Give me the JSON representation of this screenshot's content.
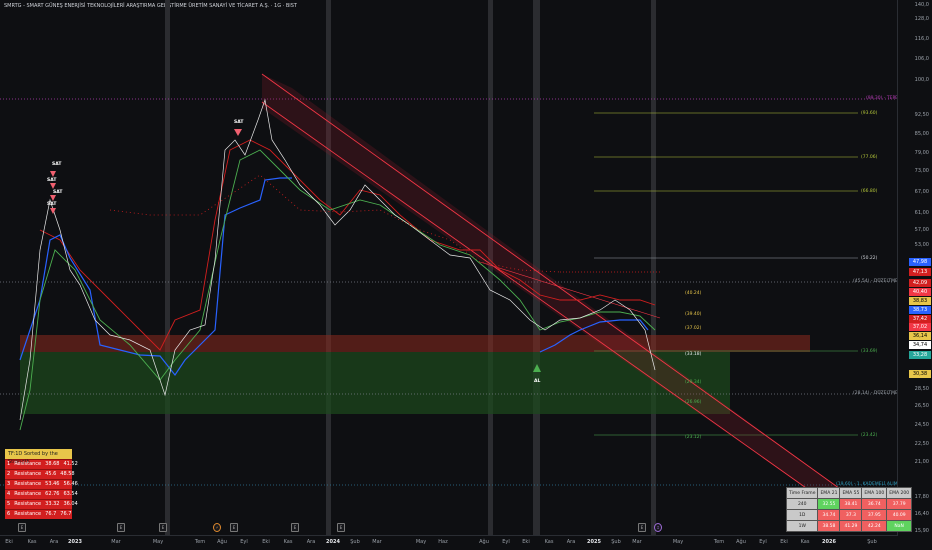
{
  "title": "SMRTG - SMART GÜNEŞ ENERJİSİ TEKNOLOJİLERİ ARAŞTIRMA GELİŞTİRME ÜRETİM SANAYİ VE TİCARET A.Ş. · 1G · BIST",
  "y_axis": {
    "scale": "log",
    "ticks": [
      "140,0",
      "128,0",
      "116,0",
      "106,0",
      "100,0",
      "92,50",
      "85,00",
      "79,00",
      "73,00",
      "67,00",
      "61,00",
      "57,00",
      "53,00",
      "49,00",
      "45,00",
      "42,00",
      "39,00",
      "36,00",
      "33,00",
      "30,50",
      "28,50",
      "26,50",
      "24,50",
      "22,50",
      "21,00",
      "19,60",
      "17,80",
      "16,40",
      "15,90"
    ],
    "price_badges": [
      {
        "text": "47,98",
        "color": "#2962ff"
      },
      {
        "text": "47,13",
        "color": "#d21f1f"
      },
      {
        "text": "42,09",
        "color": "#d21f1f"
      },
      {
        "text": "40,40",
        "color": "#f23645"
      },
      {
        "text": "38,83",
        "color": "#e8c64a"
      },
      {
        "text": "38,73",
        "color": "#2962ff"
      },
      {
        "text": "37,42",
        "color": "#d21f1f"
      },
      {
        "text": "37,02",
        "color": "#f23645"
      },
      {
        "text": "36,00",
        "color": "#e08a2e"
      },
      {
        "text": "36,14",
        "color": "#e8c64a"
      },
      {
        "text": "34,74",
        "color": "#ffffff"
      },
      {
        "text": "33,28",
        "color": "#26a69a"
      },
      {
        "text": "30,38",
        "color": "#e8c64a"
      }
    ]
  },
  "x_axis": {
    "ticks": [
      {
        "label": "Eki",
        "bold": false
      },
      {
        "label": "Kas",
        "bold": false
      },
      {
        "label": "Ara",
        "bold": false
      },
      {
        "label": "2023",
        "bold": true
      },
      {
        "label": "Mar",
        "bold": false
      },
      {
        "label": "May",
        "bold": false
      },
      {
        "label": "Tem",
        "bold": false
      },
      {
        "label": "Ağu",
        "bold": false
      },
      {
        "label": "Eyl",
        "bold": false
      },
      {
        "label": "Eki",
        "bold": false
      },
      {
        "label": "Kas",
        "bold": false
      },
      {
        "label": "Ara",
        "bold": false
      },
      {
        "label": "2024",
        "bold": true
      },
      {
        "label": "Şub",
        "bold": false
      },
      {
        "label": "Mar",
        "bold": false
      },
      {
        "label": "May",
        "bold": false
      },
      {
        "label": "Haz",
        "bold": false
      },
      {
        "label": "Ağu",
        "bold": false
      },
      {
        "label": "Eyl",
        "bold": false
      },
      {
        "label": "Eki",
        "bold": false
      },
      {
        "label": "Kas",
        "bold": false
      },
      {
        "label": "Ara",
        "bold": false
      },
      {
        "label": "2025",
        "bold": true
      },
      {
        "label": "Şub",
        "bold": false
      },
      {
        "label": "Mar",
        "bold": false
      },
      {
        "label": "May",
        "bold": false
      },
      {
        "label": "Tem",
        "bold": false
      },
      {
        "label": "Ağu",
        "bold": false
      },
      {
        "label": "Eyl",
        "bold": false
      },
      {
        "label": "Eki",
        "bold": false
      },
      {
        "label": "Kas",
        "bold": false
      },
      {
        "label": "2026",
        "bold": true
      },
      {
        "label": "Şub",
        "bold": false
      }
    ]
  },
  "events": [
    "E",
    "E",
    "E",
    "E",
    "E",
    "E",
    "E"
  ],
  "annotations": {
    "top_level": "(99,30) - TEPE",
    "level_45": "(45,54) - DÜZELTME",
    "level_28": "(28,14) - DÜZELTME",
    "bottom_level": "(19,60) - 1. KADEMELİ ALIM",
    "fib_levels": [
      "(93.60)",
      "(77.06)",
      "(66.80)",
      "(50.22)",
      "(33.69)",
      "(23.42)"
    ],
    "channel_levels": [
      "(40.24)",
      "(39.40)",
      "(37.02)",
      "(33.18)",
      "(29.34)",
      "(26.96)",
      "(23.12)"
    ],
    "sell_label": "SAT",
    "buy_label": "AL"
  },
  "sr_panel": {
    "header": "TF:1D Sorted by the Strength",
    "rows": [
      {
        "n": "1",
        "type": "Resistance",
        "a": "38.68",
        "b": "41.52"
      },
      {
        "n": "2",
        "type": "Resistance",
        "a": "45.6",
        "b": "48.58"
      },
      {
        "n": "3",
        "type": "Resistance",
        "a": "53.46",
        "b": "56.46"
      },
      {
        "n": "4",
        "type": "Resistance",
        "a": "62.76",
        "b": "63.54"
      },
      {
        "n": "5",
        "type": "Resistance",
        "a": "33.32",
        "b": "36.04"
      },
      {
        "n": "6",
        "type": "Resistance",
        "a": "76.7",
        "b": "76.7"
      }
    ]
  },
  "ema_table": {
    "headers": [
      "Time Frame",
      "EMA 21",
      "EMA 55",
      "EMA 100",
      "EMA 200"
    ],
    "rows": [
      {
        "tf": "240",
        "vals": [
          {
            "t": "32.55",
            "c": "#5fd35f"
          },
          {
            "t": "38.41",
            "c": "#f06060"
          },
          {
            "t": "36.74",
            "c": "#f06060"
          },
          {
            "t": "37.79",
            "c": "#f06060"
          }
        ]
      },
      {
        "tf": "1D",
        "vals": [
          {
            "t": "34.74",
            "c": "#f06060"
          },
          {
            "t": "37.3",
            "c": "#f06060"
          },
          {
            "t": "37.95",
            "c": "#f06060"
          },
          {
            "t": "40.09",
            "c": "#f06060"
          }
        ]
      },
      {
        "tf": "1W",
        "vals": [
          {
            "t": "38.58",
            "c": "#f06060"
          },
          {
            "t": "41.29",
            "c": "#f06060"
          },
          {
            "t": "42.24",
            "c": "#f06060"
          },
          {
            "t": "NaN",
            "c": "#5fd35f"
          }
        ]
      }
    ]
  }
}
